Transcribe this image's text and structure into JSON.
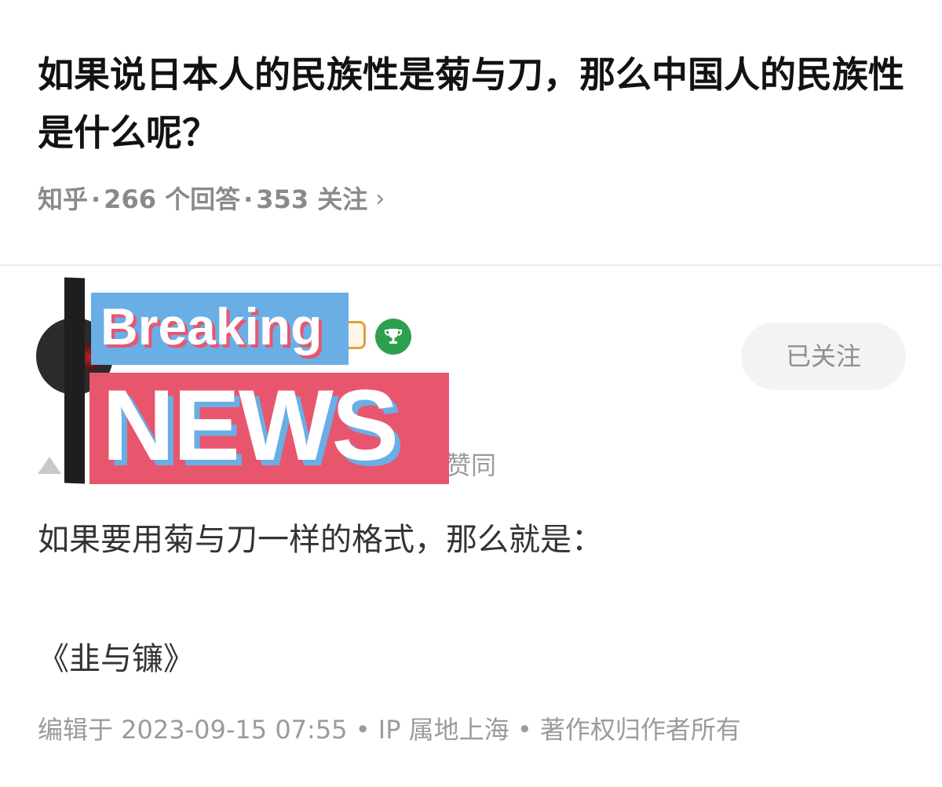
{
  "question": {
    "title": "如果说日本人的民族性是菊与刀，那么中国人的民族性是什么呢？",
    "source": "知乎",
    "answers_count": "266 个回答",
    "followers_count": "353 关注",
    "chevron_icon": "chevron-right-icon"
  },
  "author": {
    "avatar_icon": "avatar",
    "badges": [
      "gold-badge-icon",
      "trophy-icon"
    ],
    "follow_label": "已关注"
  },
  "overlay": {
    "breaking": "Breaking",
    "news": "NEWS"
  },
  "answer": {
    "vote_text": "赞同",
    "line1": "如果要用菊与刀一样的格式，那么就是：",
    "line2": "《韭与镰》",
    "footer": "编辑于 2023-09-15 07:55 • IP 属地上海 • 著作权归作者所有"
  },
  "colors": {
    "overlay_blue": "#6aaee6",
    "overlay_red": "#e8566e",
    "trophy_green": "#2e9f4e",
    "gold": "#e0a13a"
  }
}
